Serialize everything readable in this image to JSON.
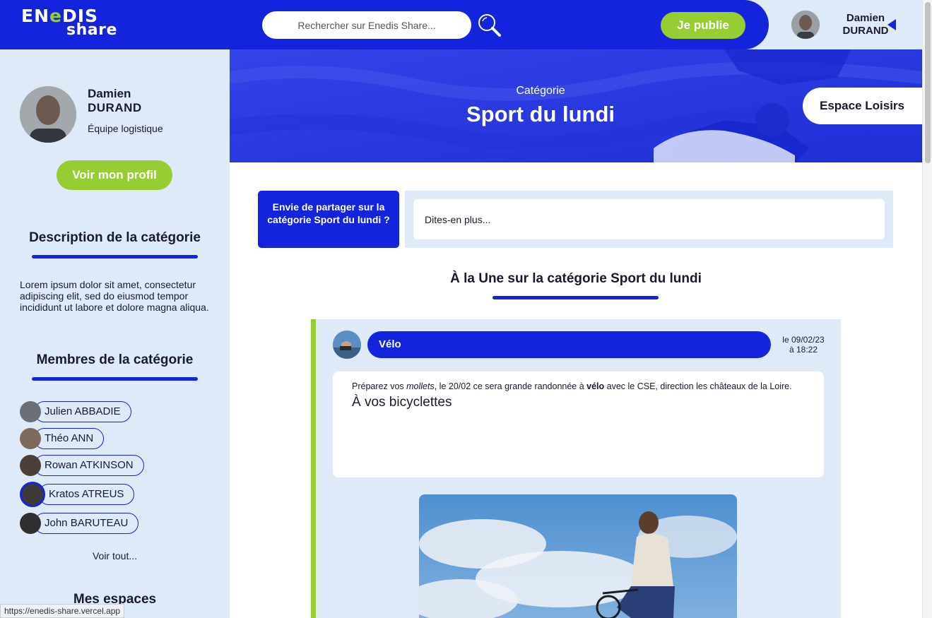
{
  "header": {
    "logo_line1_a": "EN",
    "logo_line1_b": "e",
    "logo_line1_c": "DIS",
    "logo_line2": "share",
    "search_placeholder": "Rechercher sur Enedis Share...",
    "publish_label": "Je publie",
    "user_first": "Damien",
    "user_last": "DURAND"
  },
  "sidebar": {
    "first_name": "Damien",
    "last_name": "DURAND",
    "team": "Équipe logistique",
    "profile_button": "Voir mon profil",
    "description_title": "Description de la catégorie",
    "description_text": "Lorem ipsum dolor sit amet, consectetur adipiscing elit, sed do eiusmod tempor incididunt ut labore et dolore magna aliqua.",
    "members_title": "Membres de la catégorie",
    "members": [
      {
        "name": "Julien ABBADIE"
      },
      {
        "name": "Théo ANN"
      },
      {
        "name": "Rowan ATKINSON"
      },
      {
        "name": "Kratos ATREUS"
      },
      {
        "name": "John BARUTEAU"
      }
    ],
    "see_all": "Voir tout...",
    "spaces_title": "Mes espaces"
  },
  "banner": {
    "category_label": "Catégorie",
    "title": "Sport du lundi",
    "space_label": "Espace Loisirs"
  },
  "share": {
    "label": "Envie de partager sur la catégorie Sport du lundi ?",
    "placeholder": "Dites-en plus..."
  },
  "une": {
    "title": "À la Une sur la catégorie Sport du lundi"
  },
  "post": {
    "tag": "Vélo",
    "date_line1": "le 09/02/23",
    "date_line2": "à 18:22",
    "text_prefix": "Préparez vos ",
    "text_italic": "mollets",
    "text_middle": ", le 20/02 ce sera grande randonnée à ",
    "text_bold": "vélo",
    "text_suffix": " avec le CSE, direction les châteaux de la Loire.",
    "headline": "À vos bicyclettes"
  },
  "status_url": "https://enedis-share.vercel.app",
  "colors": {
    "brand_blue": "#1423dc",
    "brand_green": "#96cd32",
    "light_bg": "#dfeaf8"
  }
}
